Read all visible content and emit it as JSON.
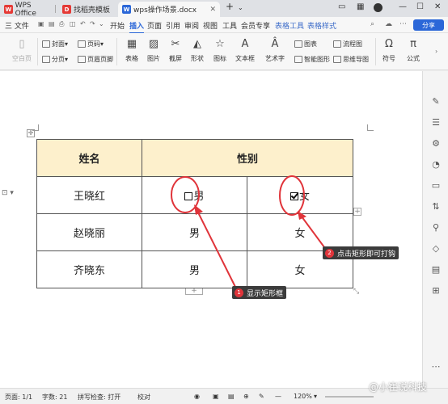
{
  "tabs": [
    {
      "label": "WPS Office",
      "icon": "wps-logo-icon",
      "color": "#e53935"
    },
    {
      "label": "找稻壳模板",
      "icon": "docer-icon",
      "color": "#e53935"
    },
    {
      "label": "wps操作场景.docx",
      "icon": "word-doc-icon",
      "color": "#2b67d8"
    }
  ],
  "menu": {
    "file": "三 文件",
    "items": [
      "开始",
      "插入",
      "页面",
      "引用",
      "审阅",
      "视图",
      "工具",
      "会员专享"
    ],
    "active": "插入",
    "context": [
      "表格工具",
      "表格样式"
    ],
    "share": "分享"
  },
  "ribbon": {
    "blank_page": "空白页",
    "cover": "封面",
    "pagenum": "页码",
    "section": "分页",
    "header_footer": "页眉页脚",
    "big": [
      "表格",
      "图片",
      "截屏",
      "形状",
      "图标",
      "文本框",
      "艺术字",
      "智能图形",
      "思维导图",
      "符号",
      "公式"
    ],
    "chart": "图表",
    "flowchart": "流程图"
  },
  "table": {
    "headers": [
      "姓名",
      "性别"
    ],
    "rows": [
      {
        "name": "王晓红",
        "left": "男",
        "right": "女"
      },
      {
        "name": "赵晓丽",
        "left": "男",
        "right": "女"
      },
      {
        "name": "齐晓东",
        "left": "男",
        "right": "女"
      }
    ]
  },
  "annotations": [
    {
      "num": "1",
      "text": "显示矩形框"
    },
    {
      "num": "2",
      "text": "点击矩形即可打钩"
    }
  ],
  "status": {
    "page": "页面: 1/1",
    "words": "字数: 21",
    "spell": "拼写检查: 打开",
    "proof": "校对",
    "zoom": "120%"
  },
  "watermark": "@小崔说科技",
  "colors": {
    "accent": "#2b67d8",
    "annotation_red": "#e0343a",
    "header_fill": "#fdf0cc"
  }
}
